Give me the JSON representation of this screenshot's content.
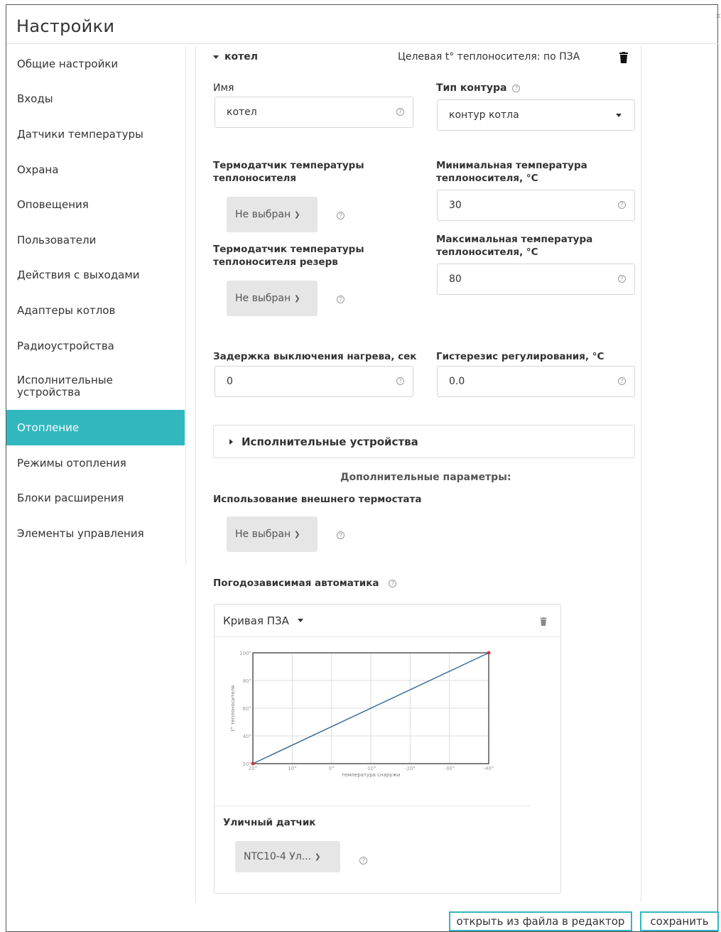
{
  "window": {
    "title": "Настройки",
    "close": "×"
  },
  "sidebar": {
    "items": [
      {
        "label": "Общие настройки"
      },
      {
        "label": "Входы"
      },
      {
        "label": "Датчики температуры"
      },
      {
        "label": "Охрана"
      },
      {
        "label": "Оповещения"
      },
      {
        "label": "Пользователи"
      },
      {
        "label": "Действия с выходами"
      },
      {
        "label": "Адаптеры котлов"
      },
      {
        "label": "Радиоустройства"
      },
      {
        "label": "Исполнительные устройства"
      },
      {
        "label": "Отопление",
        "active": true
      },
      {
        "label": "Режимы отопления"
      },
      {
        "label": "Блоки расширения"
      },
      {
        "label": "Элементы управления"
      }
    ]
  },
  "circuit": {
    "name_header": "котел",
    "target_text": "Целевая t° теплоносителя: по ПЗА",
    "name_label": "Имя",
    "name_value": "котел",
    "type_label": "Тип контура",
    "type_value": "контур котла",
    "sensor_label": "Термодатчик температуры теплоносителя",
    "sensor_value": "Не выбран",
    "sensor_reserve_label": "Термодатчик температуры теплоносителя резерв",
    "sensor_reserve_value": "Не выбран",
    "min_temp_label": "Минимальная температура теплоносителя, °C",
    "min_temp_value": "30",
    "max_temp_label": "Максимальная температура теплоносителя, °C",
    "max_temp_value": "80",
    "delay_label": "Задержка выключения нагрева, сек",
    "delay_value": "0",
    "hysteresis_label": "Гистерезис регулирования, °C",
    "hysteresis_value": "0.0",
    "actuators_label": "Исполнительные устройства",
    "extra_params_label": "Дополнительные параметры:",
    "ext_thermostat_label": "Использование внешнего термостата",
    "ext_thermostat_value": "Не выбран",
    "weather_label": "Погодозависимая автоматика",
    "curve_label": "Кривая ПЗА",
    "street_sensor_label": "Уличный датчик",
    "street_sensor_value": "NTC10-4 Ул..."
  },
  "chart_data": {
    "type": "line",
    "xlabel": "температура снаружи",
    "ylabel": "t° теплоносителя",
    "x_ticks": [
      "20°",
      "10°",
      "0°",
      "-10°",
      "-20°",
      "-30°",
      "-40°"
    ],
    "y_ticks": [
      "20°",
      "40°",
      "60°",
      "80°",
      "100°"
    ],
    "xlim": [
      20,
      -40
    ],
    "ylim": [
      20,
      100
    ],
    "grid": true,
    "series": [
      {
        "x": [
          20,
          -40
        ],
        "y": [
          20,
          100
        ],
        "color": "#3a6e9a"
      }
    ],
    "point_color": "#d9373a"
  },
  "footer": {
    "open_file_label": "открыть из файла в редактор",
    "save_label": "сохранить"
  },
  "colors": {
    "accent": "#31b8bf"
  }
}
